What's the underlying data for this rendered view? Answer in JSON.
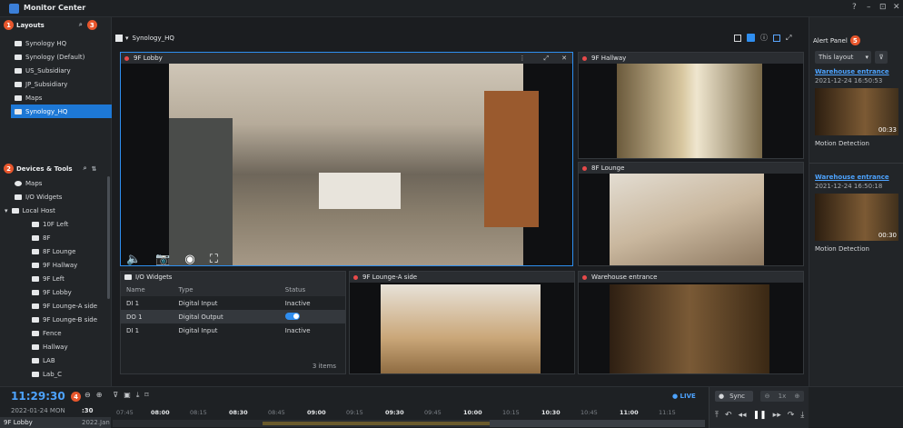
{
  "app": {
    "title": "Monitor Center"
  },
  "window": {
    "help": "?",
    "minimize": "–",
    "restore": "⊡",
    "close": "✕"
  },
  "layouts": {
    "badge": "1",
    "title": "Layouts",
    "badge3": "3",
    "items": [
      "Synology HQ",
      "Synology (Default)",
      "US_Subsidiary",
      "JP_Subsidiary",
      "Maps",
      "Synology_HQ"
    ]
  },
  "devices": {
    "badge": "2",
    "title": "Devices & Tools",
    "items": [
      "Maps",
      "I/O Widgets",
      "Local Host",
      "10F Left",
      "8F",
      "8F Lounge",
      "9F Hallway",
      "9F Left",
      "9F Lobby",
      "9F Lounge-A side",
      "9F Lounge-B side",
      "Fence",
      "Hallway",
      "LAB",
      "Lab_C"
    ]
  },
  "toolbar": {
    "layout_name": "Synology_HQ"
  },
  "tiles": {
    "lobby": "9F Lobby",
    "hallway": "9F Hallway",
    "lounge": "8F Lounge",
    "io": "I/O Widgets",
    "lounge_a": "9F Lounge-A side",
    "warehouse": "Warehouse entrance"
  },
  "io_table": {
    "headers": [
      "Name",
      "Type",
      "Status"
    ],
    "rows": [
      [
        "DI 1",
        "Digital Input",
        "Inactive"
      ],
      [
        "DO 1",
        "Digital Output",
        ""
      ],
      [
        "DI 1",
        "Digital Input",
        "Inactive"
      ]
    ],
    "count": "3 items"
  },
  "alert": {
    "badge": "5",
    "title": "Alert Panel",
    "filter": "This layout",
    "events": [
      {
        "camera": "Warehouse entrance",
        "time": "2021-12-24 16:50:53",
        "duration": "00:33",
        "type": "Motion Detection"
      },
      {
        "camera": "Warehouse entrance",
        "time": "2021-12-24 16:50:18",
        "duration": "00:30",
        "type": "Motion Detection"
      }
    ]
  },
  "timeline": {
    "clock": "11:29:30",
    "badge": "4",
    "date": "2022-01-24 MON",
    "cam": "9F Lobby",
    "cam_date": "2022.Jan",
    "seconds": ":30",
    "ticks": [
      "07:45",
      "08:00",
      "08:15",
      "08:30",
      "08:45",
      "09:00",
      "09:15",
      "09:30",
      "09:45",
      "10:00",
      "10:15",
      "10:30",
      "10:45",
      "11:00",
      "11:15"
    ],
    "live": "● LIVE",
    "sync": "Sync",
    "speed": "1x"
  }
}
